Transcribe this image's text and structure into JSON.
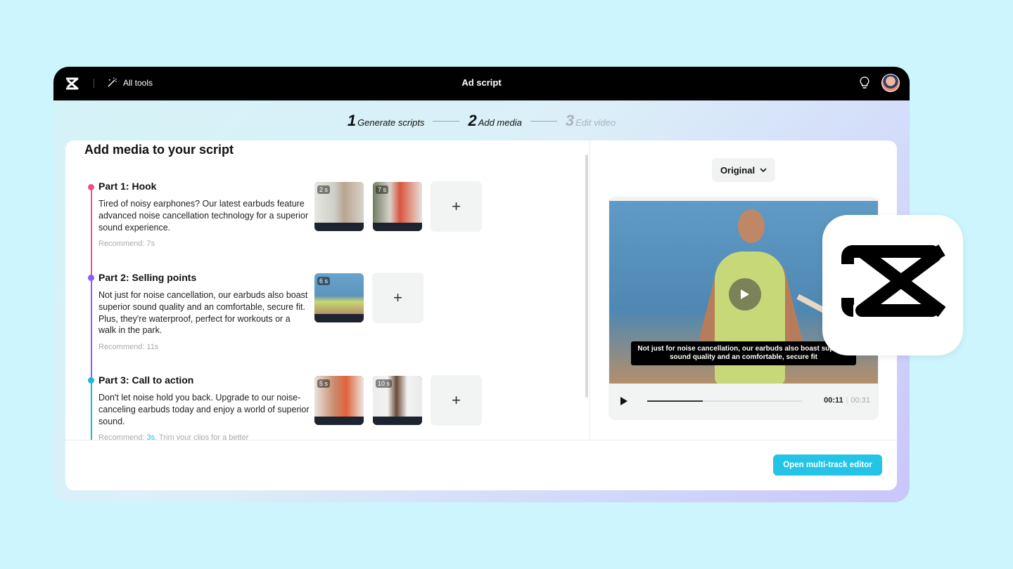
{
  "header": {
    "all_tools": "All tools",
    "title": "Ad script"
  },
  "steps": [
    {
      "num": "1",
      "label": "Generate scripts",
      "active": true
    },
    {
      "num": "2",
      "label": "Add media",
      "active": true
    },
    {
      "num": "3",
      "label": "Edit video",
      "active": false
    }
  ],
  "main": {
    "heading": "Add media to your script",
    "parts": [
      {
        "title": "Part 1: Hook",
        "text": "Tired of noisy earphones? Our latest earbuds feature advanced noise cancellation technology for a superior sound experience.",
        "recommend": "Recommend: 7s",
        "dot_color": "#f0508a",
        "clips": [
          {
            "duration": "2 s"
          },
          {
            "duration": "7 s"
          }
        ]
      },
      {
        "title": "Part 2: Selling points",
        "text": "Not just for noise cancellation, our earbuds also boast superior sound quality and an comfortable, secure fit. Plus, they're waterproof, perfect for workouts or a walk in the park.",
        "recommend": "Recommend: 11s",
        "dot_color": "#8b5cf6",
        "clips": [
          {
            "duration": "6 s"
          }
        ]
      },
      {
        "title": "Part 3: Call to action",
        "text": "Don't let noise hold you back. Upgrade to our noise-canceling earbuds today and enjoy a world of superior sound.",
        "recommend_prefix": "Recommend: ",
        "recommend_highlight": "3s",
        "recommend_suffix": ". Trim your clips for a better",
        "dot_color": "#1fb6d6",
        "clips": [
          {
            "duration": "5 s"
          },
          {
            "duration": "10 s"
          }
        ]
      }
    ],
    "add_symbol": "+"
  },
  "preview": {
    "ratio": "Original",
    "subtitle": "Not just for noise cancellation, our earbuds also boast superior sound quality and an comfortable, secure fit",
    "current_time": "00:11",
    "total_time": "00:31",
    "progress": 0.36
  },
  "footer": {
    "open_editor": "Open multi-track editor"
  },
  "colors": {
    "accent": "#23c4e6",
    "background": "#cdf5fe"
  }
}
